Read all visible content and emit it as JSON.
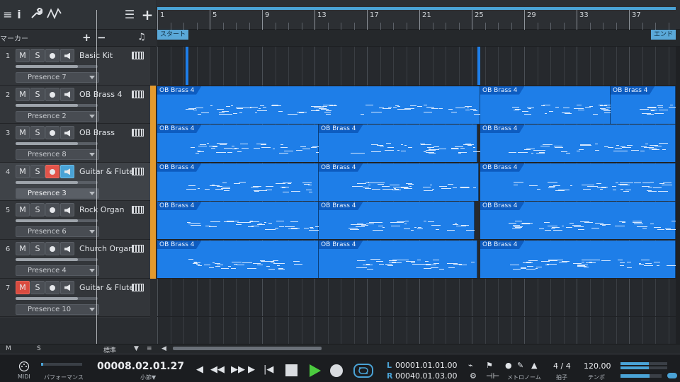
{
  "toolbar": {
    "icons": [
      "menu-icon",
      "info-icon",
      "wrench-icon",
      "automation-icon",
      "list-icon",
      "add-icon"
    ],
    "info_glyph": "i",
    "add_glyph": "+"
  },
  "markers": {
    "label": "マーカー",
    "add": "+",
    "remove": "−",
    "note_glyph": "♫"
  },
  "ruler": {
    "bars": [
      "1",
      "5",
      "9",
      "13",
      "17",
      "21",
      "25",
      "29",
      "33",
      "37"
    ],
    "start_flag": "スタート",
    "end_flag": "エンド"
  },
  "tracks": [
    {
      "num": "1",
      "name": "Basic Kit",
      "preset": "Presence 7",
      "mute": false,
      "rec": false,
      "monitor": false,
      "selected": false,
      "has_color": false
    },
    {
      "num": "2",
      "name": "OB Brass 4",
      "preset": "Presence 2",
      "mute": false,
      "rec": false,
      "monitor": false,
      "selected": false,
      "has_color": true
    },
    {
      "num": "3",
      "name": "OB Brass",
      "preset": "Presence 8",
      "mute": false,
      "rec": false,
      "monitor": false,
      "selected": false,
      "has_color": true
    },
    {
      "num": "4",
      "name": "Guitar & Flute",
      "preset": "Presence 3",
      "mute": false,
      "rec": true,
      "monitor": true,
      "selected": true,
      "has_color": true
    },
    {
      "num": "5",
      "name": "Rock Organ",
      "preset": "Presence 6",
      "mute": false,
      "rec": false,
      "monitor": false,
      "selected": false,
      "has_color": true
    },
    {
      "num": "6",
      "name": "Church Organ",
      "preset": "Presence 4",
      "mute": false,
      "rec": false,
      "monitor": false,
      "selected": false,
      "has_color": true
    },
    {
      "num": "7",
      "name": "Guitar & Flute",
      "preset": "Presence 10",
      "mute": true,
      "rec": false,
      "monitor": false,
      "selected": false,
      "has_color": false
    }
  ],
  "track_buttons": {
    "mute": "M",
    "solo": "S"
  },
  "part_label": "OB Brass 4",
  "bottom": {
    "m": "M",
    "s": "S",
    "view": "標準",
    "view_chev": "▼",
    "list_glyph": "≡",
    "scroll_left": "◀"
  },
  "transport": {
    "midi_label": "MIDI",
    "performance_label": "パフォーマンス",
    "position": "00008.02.01.27",
    "position_unit": "小節▼",
    "l_label": "L",
    "r_label": "R",
    "left_locator": "00001.01.01.00",
    "right_locator": "00040.01.03.00",
    "metronome_label": "メトロノーム",
    "signature": "4 / 4",
    "signature_label": "拍子",
    "tempo": "120.00",
    "tempo_label": "テンポ",
    "accent_color": "#4aa3d6",
    "play_color": "#4ccb3f"
  }
}
